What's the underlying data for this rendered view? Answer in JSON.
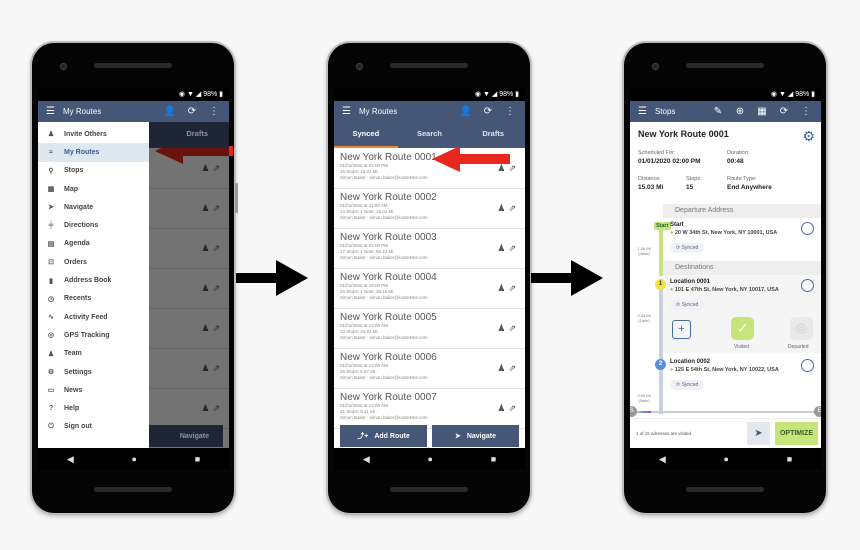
{
  "status": {
    "battery": "98%"
  },
  "phone1": {
    "title": "My Routes",
    "background_tab": "Drafts",
    "background_button": "Navigate",
    "menu": [
      {
        "label": "Invite Others",
        "icon": "invite-icon"
      },
      {
        "label": "My Routes",
        "icon": "routes-icon",
        "active": true
      },
      {
        "label": "Stops",
        "icon": "stops-icon"
      },
      {
        "label": "Map",
        "icon": "map-icon"
      },
      {
        "label": "Navigate",
        "icon": "navigate-icon"
      },
      {
        "label": "Directions",
        "icon": "directions-icon"
      },
      {
        "label": "Agenda",
        "icon": "agenda-icon"
      },
      {
        "label": "Orders",
        "icon": "cart-icon"
      },
      {
        "label": "Address Book",
        "icon": "address-book-icon"
      },
      {
        "label": "Recents",
        "icon": "clock-icon"
      },
      {
        "label": "Activity Feed",
        "icon": "activity-icon"
      },
      {
        "label": "GPS Tracking",
        "icon": "gps-icon"
      },
      {
        "label": "Team",
        "icon": "team-icon"
      },
      {
        "label": "Settings",
        "icon": "settings-icon"
      },
      {
        "label": "News",
        "icon": "news-icon"
      },
      {
        "label": "Help",
        "icon": "help-icon"
      },
      {
        "label": "Sign out",
        "icon": "power-icon"
      }
    ]
  },
  "phone2": {
    "title": "My Routes",
    "tabs": [
      "Synced",
      "Search",
      "Drafts"
    ],
    "routes": [
      {
        "name": "New York Route 0001",
        "date": "01/01/2020 at 02:00 PM",
        "info": "15 Stops; 15.01 Mi",
        "owner": "Simon Baker - simon.baker@route4me.com"
      },
      {
        "name": "New York Route 0002",
        "date": "01/01/2020 at 11:00 AM",
        "info": "14 Stops; 1 Note; 15.01 Mi",
        "owner": "Simon Baker - simon.baker@route4me.com"
      },
      {
        "name": "New York Route 0003",
        "date": "01/01/2020 at 02:00 PM",
        "info": "17 Stops; 1 Note; 50.23 Mi",
        "owner": "Simon Baker - simon.baker@route4me.com"
      },
      {
        "name": "New York Route 0004",
        "date": "01/01/2020 at 10:00 PM",
        "info": "20 Stops; 1 Note; 38.15 Mi",
        "owner": "Simon Baker - simon.baker@route4me.com"
      },
      {
        "name": "New York Route 0005",
        "date": "01/01/2020 at 12:00 AM",
        "info": "23 Stops; 24.83 Mi",
        "owner": "Simon Baker - simon.baker@route4me.com"
      },
      {
        "name": "New York Route 0006",
        "date": "01/01/2020 at 12:00 AM",
        "info": "28 Stops; 6.57 Mi",
        "owner": "Simon Baker - simon.baker@route4me.com"
      },
      {
        "name": "New York Route 0007",
        "date": "01/01/2020 at 12:00 AM",
        "info": "31 Stops; 8.11 Mi",
        "owner": "Simon Baker - simon.baker@route4me.com"
      }
    ],
    "add_route": "Add Route",
    "navigate": "Navigate"
  },
  "phone3": {
    "title": "Stops",
    "route_name": "New York Route 0001",
    "scheduled_label": "Scheduled For:",
    "scheduled": "01/01/2020  02:00 PM",
    "duration_label": "Duration:",
    "duration": "00:48",
    "distance_label": "Distance:",
    "distance": "15.03 Mi",
    "stops_label": "Stops:",
    "stops": "15",
    "route_type_label": "Route Type:",
    "route_type": "End Anywhere",
    "departure_header": "Departure Address",
    "destinations_header": "Destinations",
    "start_badge": "Start",
    "start": {
      "name": "Start",
      "address": "20 W 34th St, New York, NY 10001, USA",
      "status": "Synced",
      "leg": "1.26 Mi",
      "leg_time": "(4min)"
    },
    "stops_list": [
      {
        "num": "1",
        "name": "Location 0001",
        "address": "101 E 47th St, New York, NY 10017, USA",
        "status": "Synced",
        "leg": "0.43 Mi",
        "leg_time": "(1min)",
        "color": "#f2e33c"
      },
      {
        "num": "2",
        "name": "Location 0002",
        "address": "125 E 54th St, New York, NY 10022, USA",
        "status": "Synced",
        "leg": "0.95 Mi",
        "leg_time": "(3min)",
        "color": "#5b8fd6"
      }
    ],
    "visited_label": "Visited",
    "departed_label": "Departed",
    "slider_start": "S",
    "slider_end": "E",
    "visited_summary": "1 of 15 adresses are visited.",
    "optimize": "OPTIMIZE",
    "accent": "#c5e57a"
  },
  "colors": {
    "appbar": "#455677",
    "tab_indicator": "#f08a2c",
    "annotation_arrow": "#e8281f"
  }
}
